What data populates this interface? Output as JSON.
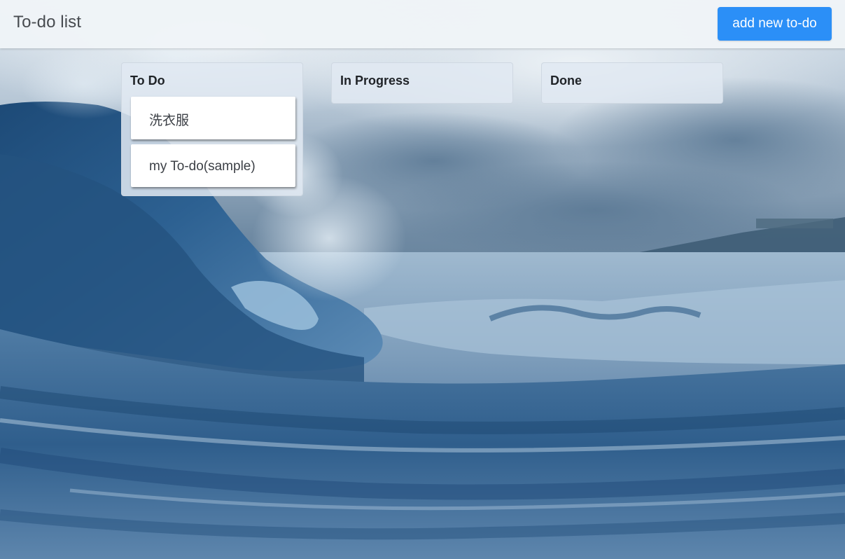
{
  "navbar": {
    "brand": "To-do list",
    "add_button_label": "add new to-do",
    "add_button_color": "#2b8ff7"
  },
  "background": {
    "description_icon": "ocean-wave-photo"
  },
  "columns": [
    {
      "title": "To Do",
      "cards": [
        "洗衣服",
        "my To-do(sample)"
      ]
    },
    {
      "title": "In Progress",
      "cards": []
    },
    {
      "title": "Done",
      "cards": []
    }
  ]
}
